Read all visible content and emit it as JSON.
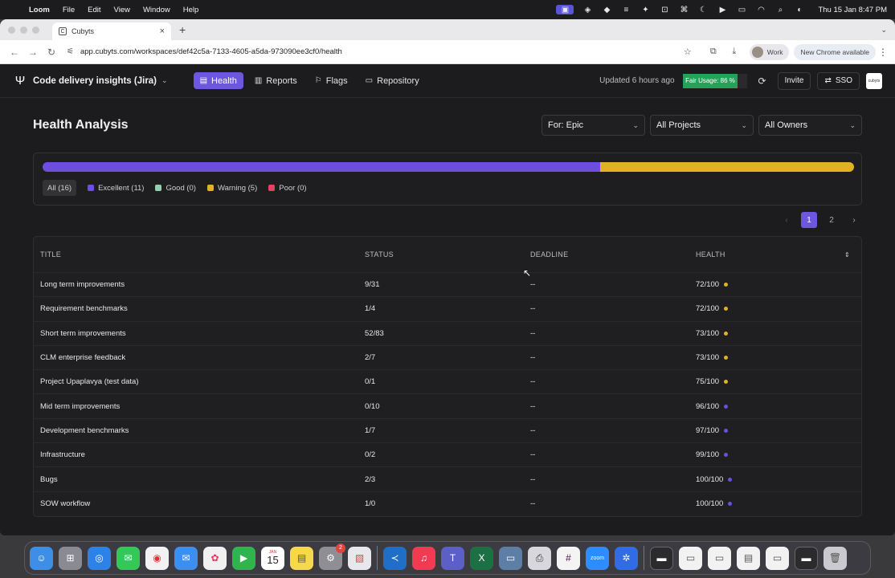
{
  "menubar": {
    "app_name": "Loom",
    "items": [
      "File",
      "Edit",
      "View",
      "Window",
      "Help"
    ],
    "clock": "Thu 15 Jan  8:47 PM"
  },
  "browser": {
    "tab_title": "Cubyts",
    "url": "app.cubyts.com/workspaces/def42c5a-7133-4605-a5da-973090ee3cf0/health",
    "profile_label": "Work",
    "update_label": "New Chrome available"
  },
  "appbar": {
    "workspace": "Code delivery insights (Jira)",
    "nav": [
      {
        "label": "Health",
        "icon": "document-icon",
        "active": true
      },
      {
        "label": "Reports",
        "icon": "chart-icon",
        "active": false
      },
      {
        "label": "Flags",
        "icon": "flag-icon",
        "active": false
      },
      {
        "label": "Repository",
        "icon": "folder-icon",
        "active": false
      }
    ],
    "updated": "Updated 6 hours ago",
    "usage_label": "Fair Usage: 86 %",
    "usage_fraction": 0.86,
    "invite_label": "Invite",
    "sso_label": "SSO",
    "brand_logo_text": "cubyts"
  },
  "page": {
    "title": "Health Analysis",
    "filters": {
      "for": "For: Epic",
      "projects": "All Projects",
      "owners": "All Owners"
    }
  },
  "summary": {
    "segments": [
      {
        "name": "Excellent",
        "value": 11,
        "color": "#6d4fe0"
      },
      {
        "name": "Warning",
        "value": 5,
        "color": "#e0b224"
      }
    ],
    "legend": [
      {
        "label": "All (16)",
        "color": null,
        "active": true
      },
      {
        "label": "Excellent (11)",
        "color": "#6d4fe0",
        "active": false
      },
      {
        "label": "Good (0)",
        "color": "#8fd1b0",
        "active": false
      },
      {
        "label": "Warning (5)",
        "color": "#e0b224",
        "active": false
      },
      {
        "label": "Poor (0)",
        "color": "#e0445e",
        "active": false
      }
    ]
  },
  "pagination": {
    "prev": "‹",
    "pages": [
      "1",
      "2"
    ],
    "current": "1",
    "next": "›"
  },
  "table": {
    "headers": {
      "title": "TITLE",
      "status": "STATUS",
      "deadline": "DEADLINE",
      "health": "HEALTH"
    },
    "rows": [
      {
        "title": "Long term improvements",
        "status": "9/31",
        "deadline": "--",
        "health": "72/100",
        "dot": "#e0b224"
      },
      {
        "title": "Requirement benchmarks",
        "status": "1/4",
        "deadline": "--",
        "health": "72/100",
        "dot": "#e0b224"
      },
      {
        "title": "Short term improvements",
        "status": "52/83",
        "deadline": "--",
        "health": "73/100",
        "dot": "#e0b224"
      },
      {
        "title": "CLM enterprise feedback",
        "status": "2/7",
        "deadline": "--",
        "health": "73/100",
        "dot": "#e0b224"
      },
      {
        "title": "Project Upaplavya (test data)",
        "status": "0/1",
        "deadline": "--",
        "health": "75/100",
        "dot": "#e0b224"
      },
      {
        "title": "Mid term improvements",
        "status": "0/10",
        "deadline": "--",
        "health": "96/100",
        "dot": "#6d4fe0"
      },
      {
        "title": "Development benchmarks",
        "status": "1/7",
        "deadline": "--",
        "health": "97/100",
        "dot": "#6d4fe0"
      },
      {
        "title": "Infrastructure",
        "status": "0/2",
        "deadline": "--",
        "health": "99/100",
        "dot": "#6d4fe0"
      },
      {
        "title": "Bugs",
        "status": "2/3",
        "deadline": "--",
        "health": "100/100",
        "dot": "#6d4fe0"
      },
      {
        "title": "SOW workflow",
        "status": "1/0",
        "deadline": "--",
        "health": "100/100",
        "dot": "#6d4fe0"
      }
    ]
  },
  "dock": {
    "calendar_month": "JAN",
    "calendar_day": "15",
    "settings_badge": "2",
    "zoom_label": "zoom",
    "apps": [
      "finder",
      "launchpad",
      "safari",
      "messages",
      "chrome",
      "mail",
      "photos",
      "facetime",
      "calendar",
      "notes",
      "settings",
      "preview",
      "vscode",
      "music",
      "teams",
      "excel",
      "screen-share",
      "printer",
      "slack",
      "zoom",
      "kubernetes",
      "terminal",
      "window-1",
      "window-2",
      "window-3",
      "window-4",
      "window-5",
      "trash"
    ]
  }
}
